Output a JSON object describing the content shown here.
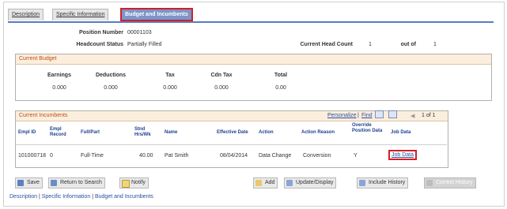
{
  "tabs": [
    {
      "label": "Description"
    },
    {
      "label": "Specific Information"
    },
    {
      "label": "Budget and Incumbents"
    }
  ],
  "position": {
    "number_label": "Position Number",
    "number_value": "00001103",
    "headcount_label": "Headcount Status",
    "headcount_value": "Partially Filled",
    "current_head_count_label": "Current Head Count",
    "current_head_count_value": "1",
    "out_of_label": "out of",
    "out_of_value": "1"
  },
  "budget": {
    "title": "Current Budget",
    "headers": [
      "Earnings",
      "Deductions",
      "Tax",
      "Cdn Tax",
      "Total"
    ],
    "values": [
      "0.000",
      "0.000",
      "0.000",
      "0.000",
      "0.00"
    ]
  },
  "incumbents": {
    "title": "Current Incumbents",
    "personalize": "Personalize",
    "find": "Find",
    "pager": "1 of 1",
    "headers": {
      "empl_id": "Empl ID",
      "empl_record": "Empl Record",
      "full_part": "Full/Part",
      "std_hrs": "Stnd Hrs/Wk",
      "name": "Name",
      "effective_date": "Effective Date",
      "action": "Action",
      "action_reason": "Action Reason",
      "override": "Override Position Data",
      "job_data": "Job Data"
    },
    "row": {
      "empl_id": "101000718",
      "empl_record": "0",
      "full_part": "Full-Time",
      "std_hrs": "40.00",
      "name": "Pat Smith",
      "effective_date": "08/04/2014",
      "action": "Data Change",
      "action_reason": "Conversion",
      "override": "Y",
      "job_data": "Job Data"
    }
  },
  "toolbar": {
    "save": "Save",
    "return_to_search": "Return to Search",
    "notify": "Notify",
    "add": "Add",
    "update_display": "Update/Display",
    "include_history": "Include History",
    "correct_history": "Correct History"
  },
  "footer": {
    "link1": "Description",
    "link2": "Specific Information",
    "link3": "Budget and Incumbents",
    "sep": "|"
  },
  "colors": {
    "highlight": "#d21f27",
    "tab_active": "#7d95c8",
    "group_header": "#fbeedd"
  }
}
